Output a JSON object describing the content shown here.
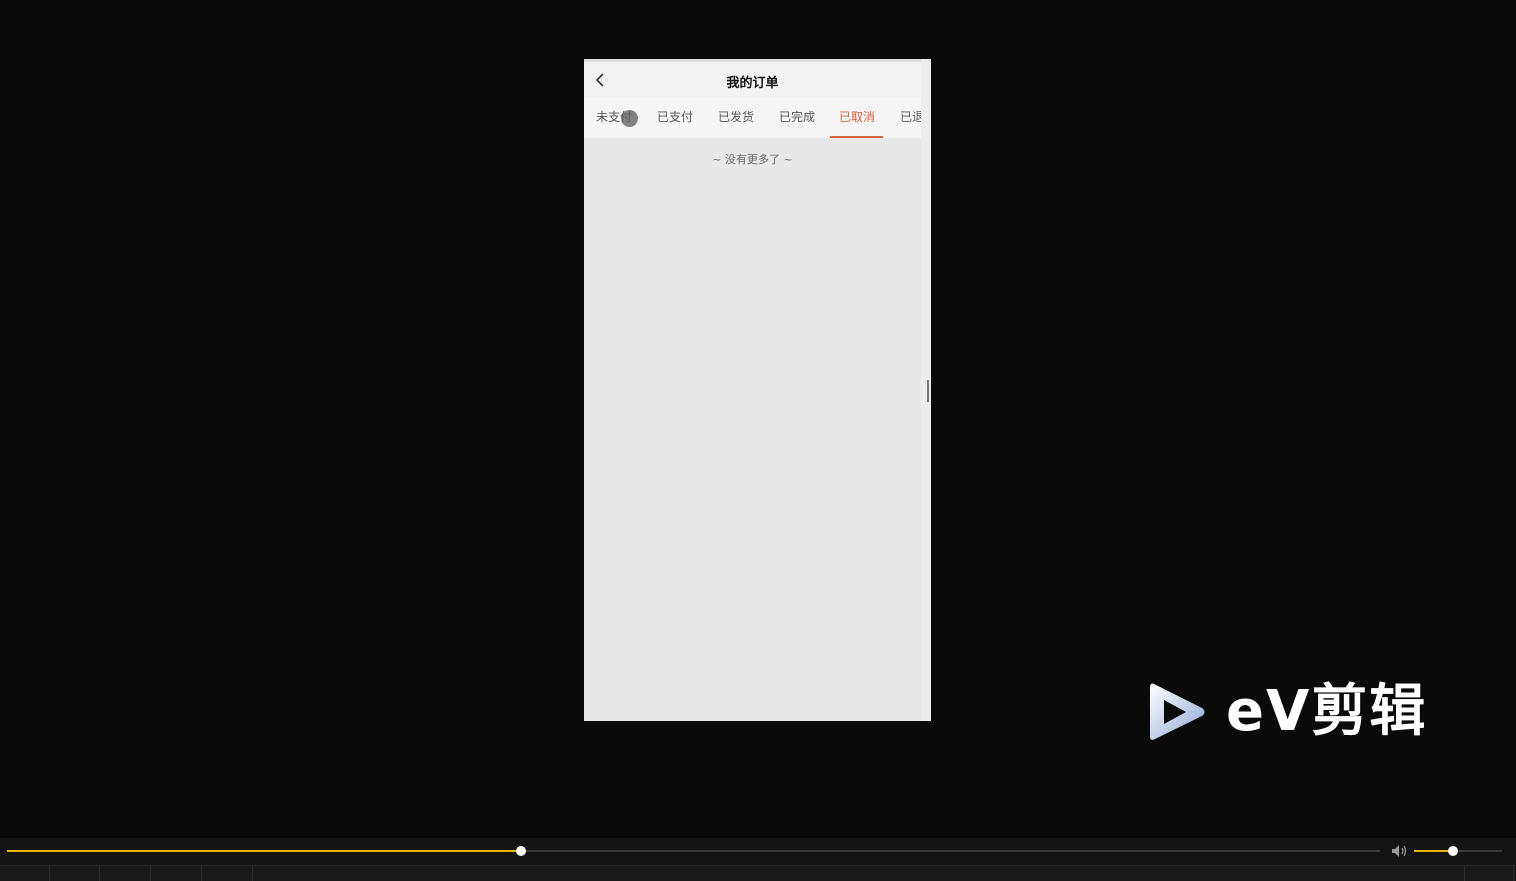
{
  "app": {
    "nav_title": "我的订单",
    "tabs": [
      {
        "label": "未支付",
        "active": false
      },
      {
        "label": "已支付",
        "active": false
      },
      {
        "label": "已发货",
        "active": false
      },
      {
        "label": "已完成",
        "active": false
      },
      {
        "label": "已取消",
        "active": true
      },
      {
        "label": "已退",
        "active": false
      }
    ],
    "empty_message": "~ 没有更多了 ~",
    "accent_color": "#d9613f",
    "back_icon": "chevron-left-icon"
  },
  "watermark": {
    "text": "eV剪辑",
    "icon": "play-logo-icon"
  },
  "player": {
    "seek_progress": 0.374,
    "volume_level": 0.44,
    "accent_color": "#e6b800",
    "volume_icon": "speaker-icon"
  }
}
